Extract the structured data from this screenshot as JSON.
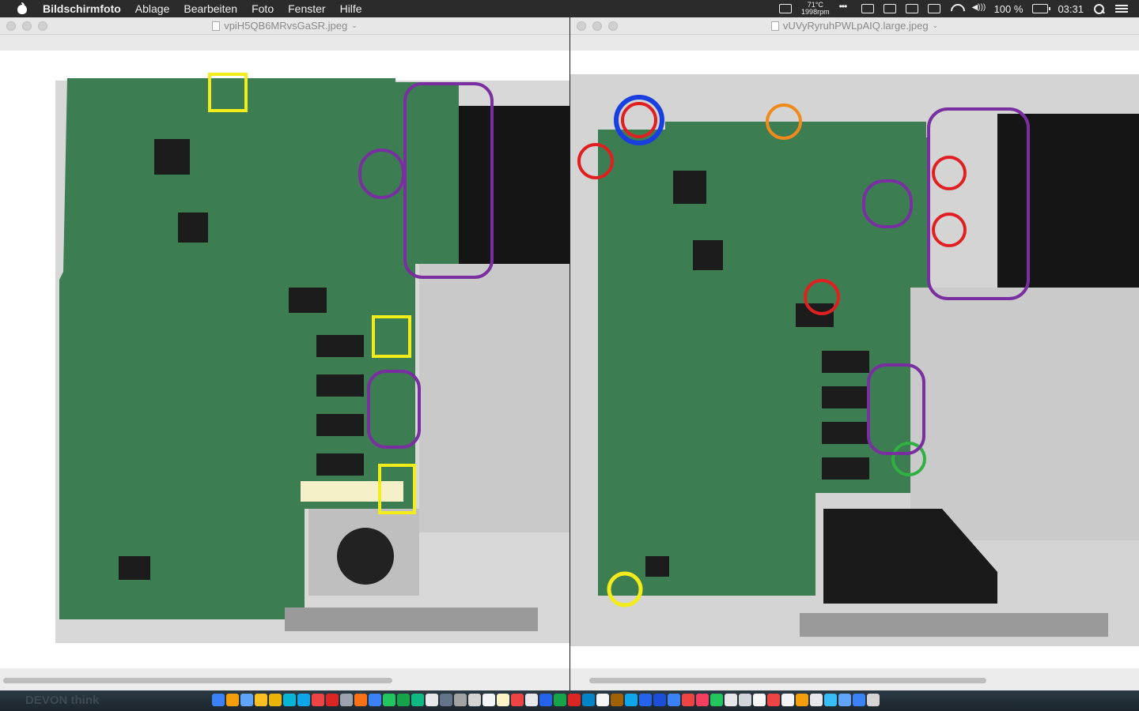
{
  "menubar": {
    "app_name": "Bildschirmfoto",
    "menus": [
      "Ablage",
      "Bearbeiten",
      "Foto",
      "Fenster",
      "Hilfe"
    ],
    "temp": "71°C",
    "fan": "1998rpm",
    "battery": "100 %",
    "clock": "03:31"
  },
  "windows": {
    "left": {
      "title": "vpiH5QB6MRvsGaSR.jpeg"
    },
    "right": {
      "title": "vUVyRyruhPWLpAIQ.large.jpeg"
    }
  },
  "dock": {
    "label": "DEVON think"
  },
  "colors": {
    "board": "#3c7d52",
    "annotation_yellow": "#f2ec1a",
    "annotation_purple": "#7a2fa0",
    "annotation_red": "#e02020",
    "annotation_blue": "#1a3fe0",
    "annotation_orange": "#f08a1a",
    "annotation_green": "#30b040"
  }
}
